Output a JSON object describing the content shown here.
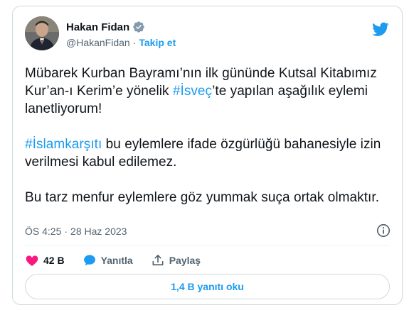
{
  "author": {
    "name": "Hakan Fidan",
    "handle": "@HakanFidan",
    "separator": "·",
    "follow_label": "Takip et"
  },
  "tweet": {
    "p1_part1": "Mübarek Kurban Bayramı’nın ilk gününde Kutsal Kitabımız Kur’an-ı Kerim’e yönelik ",
    "p1_hashtag": "#İsveç",
    "p1_part2": "’te yapılan aşağılık eylemi lanetliyorum!",
    "p2_hashtag": "#İslamkarşıtı",
    "p2_text": " bu eylemlere ifade özgürlüğü bahanesiyle izin verilmesi kabul edilemez.",
    "p3_text": "Bu tarz menfur eylemlere göz yummak suça ortak olmaktır."
  },
  "meta": {
    "time": "ÖS 4:25",
    "separator": "·",
    "date": "28 Haz 2023"
  },
  "actions": {
    "likes_count": "42 B",
    "reply_label": "Yanıtla",
    "share_label": "Paylaş"
  },
  "replies_button": "1,4 B yanıtı oku",
  "colors": {
    "link": "#1d9bf0",
    "like": "#f91880",
    "secondary_text": "#536471",
    "border": "#cfd9de"
  },
  "icons": [
    "verified-badge-icon",
    "twitter-bird-icon",
    "info-icon",
    "heart-icon",
    "reply-bubble-icon",
    "share-icon"
  ]
}
